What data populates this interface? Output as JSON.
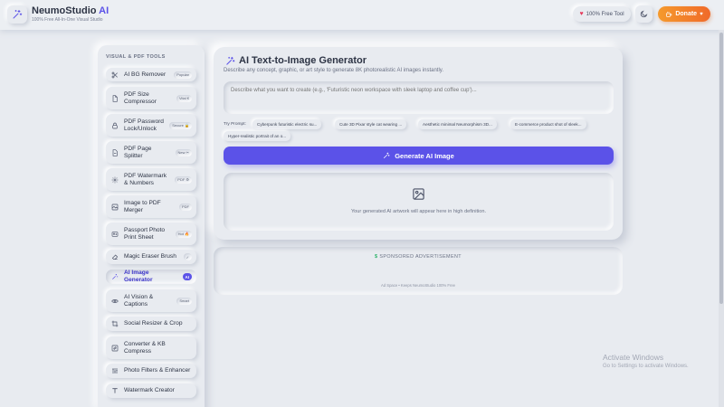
{
  "header": {
    "brand_name": "NeumoStudio",
    "brand_accent": "AI",
    "tagline": "100% Free All-In-One Visual Studio",
    "free_tool_label": "100% Free Tool",
    "donate_label": "Donate",
    "logo_icon": "sparkles-icon",
    "theme_icon": "moon-icon"
  },
  "sidebar": {
    "heading": "VISUAL & PDF TOOLS",
    "items": [
      {
        "label": "AI BG Remover",
        "badge": "Popular",
        "icon": "scissors-icon"
      },
      {
        "label": "PDF Size Compressor",
        "badge": "Vital €",
        "icon": "file-icon"
      },
      {
        "label": "PDF Password Lock/Unlock",
        "badge": "Secure 🔒",
        "icon": "lock-icon"
      },
      {
        "label": "PDF Page Splitter",
        "badge": "New ✂",
        "icon": "file-split-icon"
      },
      {
        "label": "PDF Watermark & Numbers",
        "badge": "PDF ⚙",
        "icon": "gear-icon"
      },
      {
        "label": "Image to PDF Merger",
        "badge": "PDF",
        "icon": "merge-icon"
      },
      {
        "label": "Passport Photo Print Sheet",
        "badge": "Hot 🔥",
        "icon": "id-card-icon"
      },
      {
        "label": "Magic Eraser Brush",
        "badge": "✓",
        "icon": "eraser-icon"
      },
      {
        "label": "AI Image Generator",
        "badge": "AI",
        "icon": "magic-wand-icon"
      },
      {
        "label": "AI Vision & Captions",
        "badge": "Smart",
        "icon": "eye-icon"
      },
      {
        "label": "Social Resizer & Crop",
        "badge": "",
        "icon": "crop-icon"
      },
      {
        "label": "Converter & KB Compress",
        "badge": "",
        "icon": "convert-icon"
      },
      {
        "label": "Photo Filters & Enhancer",
        "badge": "",
        "icon": "sliders-icon"
      },
      {
        "label": "Watermark Creator",
        "badge": "",
        "icon": "text-icon"
      }
    ]
  },
  "main": {
    "title": "AI Text-to-Image Generator",
    "subtitle": "Describe any concept, graphic, or art style to generate 8K photorealistic AI images instantly.",
    "prompt_placeholder": "Describe what you want to create (e.g., 'Futuristic neon workspace with sleek laptop and coffee cup')...",
    "try_prompt_label": "Try Prompt:",
    "prompts": [
      "Cyberpunk futuristic electric su...",
      "Cute 3D Pixar style cat wearing ...",
      "Aesthetic minimal Neumorphism 3D...",
      "E-commerce product shot of sleek...",
      "Hyper-realistic portrait of an o..."
    ],
    "generate_label": "Generate AI Image",
    "preview_text": "Your generated AI artwork will appear here in high definition."
  },
  "ad": {
    "title": "SPONSORED ADVERTISEMENT",
    "note": "Ad Space • Keeps NeumoStudio 100% Free"
  },
  "windows_notice": {
    "title": "Activate Windows",
    "subtitle": "Go to Settings to activate Windows."
  },
  "colors": {
    "background": "#e8ebf0",
    "accent": "#5b52e8",
    "donate_start": "#f59a2c",
    "donate_end": "#f06a2a"
  }
}
